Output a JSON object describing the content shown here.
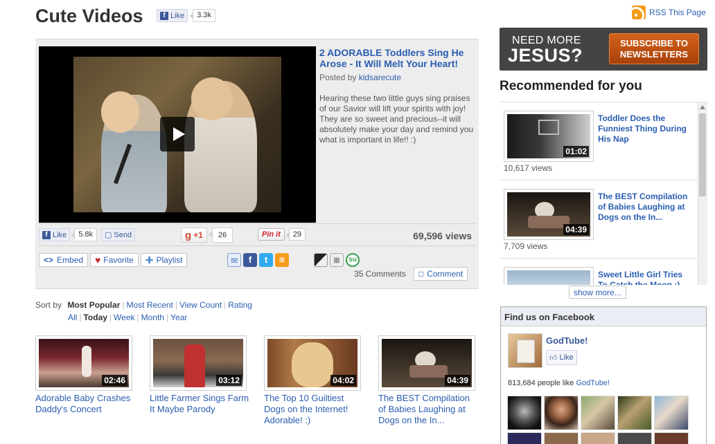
{
  "header": {
    "title": "Cute Videos",
    "like_label": "Like",
    "like_count": "3.3k",
    "rss_label": "RSS This Page"
  },
  "video": {
    "title": "2 ADORABLE Toddlers Sing He Arose - It Will Melt Your Heart!",
    "posted_by_prefix": "Posted by ",
    "author": "kidsarecute",
    "description": "Hearing these two little guys sing praises of our Savior will lift your spirits with joy! They are so sweet and precious--it will absolutely make your day and remind you what is important in life!! :)",
    "views": "69,596 views",
    "comments": "35 Comments"
  },
  "social": {
    "fb_like_label": "Like",
    "fb_like_count": "5.8k",
    "send_label": "Send",
    "gplus_label": "+1",
    "gplus_count": "26",
    "pinit_label": "Pin it",
    "pinit_count": "29"
  },
  "actions": {
    "embed": "Embed",
    "favorite": "Favorite",
    "playlist": "Playlist",
    "comment": "Comment"
  },
  "sort": {
    "label": "Sort by",
    "options": [
      "Most Popular",
      "Most Recent",
      "View Count",
      "Rating"
    ],
    "active_option": "Most Popular",
    "time_options": [
      "All",
      "Today",
      "Week",
      "Month",
      "Year"
    ],
    "active_time": "Today"
  },
  "grid": [
    {
      "title": "Adorable Baby Crashes Daddy's Concert",
      "duration": "02:46"
    },
    {
      "title": "Little Farmer Sings Farm It Maybe Parody",
      "duration": "03:12"
    },
    {
      "title": "The Top 10 Guiltiest Dogs on the Internet! Adorable! :)",
      "duration": "04:02"
    },
    {
      "title": "The BEST Compilation of Babies Laughing at Dogs on the In...",
      "duration": "04:39"
    }
  ],
  "banner": {
    "line1": "NEED MORE",
    "line2": "JESUS?",
    "button": "SUBSCRIBE TO NEWSLETTERS"
  },
  "recommended": {
    "heading": "Recommended for you",
    "items": [
      {
        "title": "Toddler Does the Funniest Thing During His Nap",
        "duration": "01:02",
        "views": "10,617 views"
      },
      {
        "title": "The BEST Compilation of Babies Laughing at Dogs on the In...",
        "duration": "04:39",
        "views": "7,709 views"
      },
      {
        "title": "Sweet Little Girl Tries To Catch the Moon :)",
        "duration": "",
        "views": ""
      }
    ],
    "show_more": "show more..."
  },
  "facebook": {
    "heading": "Find us on Facebook",
    "page_name": "GodTube!",
    "like_label": "Like",
    "people_prefix": "813,684 people like ",
    "people_page": "GodTube!"
  },
  "colors": {
    "link": "#2a5db0",
    "facebook": "#3b5998",
    "banner_bg": "#444444",
    "subscribe": "#c4561a",
    "rss": "#f69c1c"
  }
}
